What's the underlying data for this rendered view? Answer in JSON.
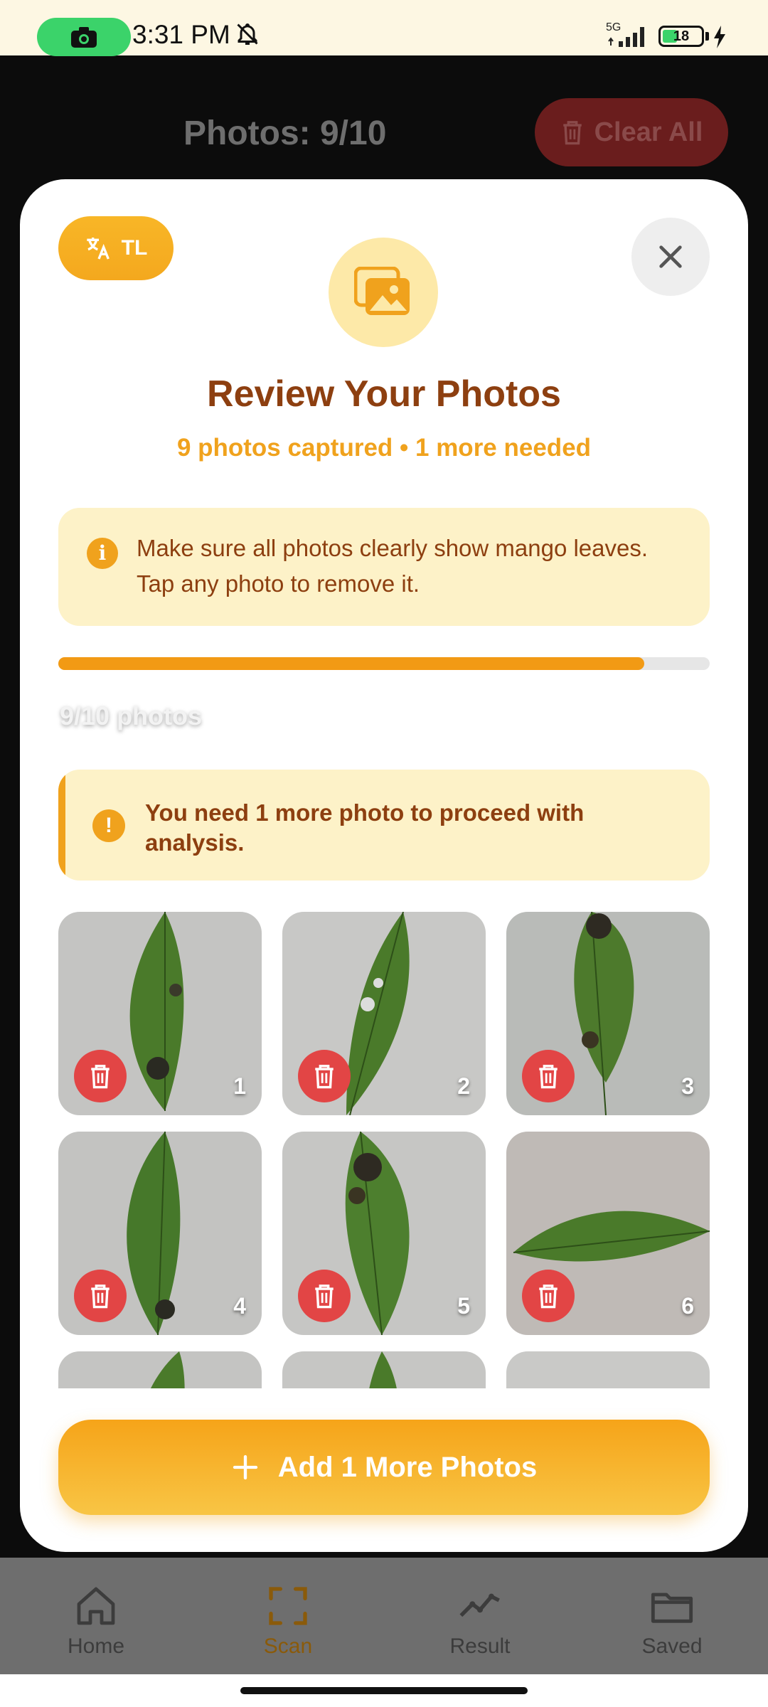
{
  "status_bar": {
    "time": "3:31 PM",
    "network": "5G",
    "battery": "18",
    "icons": [
      "screen-record-icon",
      "bell-off-icon",
      "signal-icon",
      "battery-icon",
      "charging-icon"
    ]
  },
  "background": {
    "title": "Photos: 9/10",
    "clear_all_label": "Clear All"
  },
  "modal": {
    "language_label": "TL",
    "title": "Review Your Photos",
    "subtitle": "9 photos captured • 1 more needed",
    "info_text": "Make sure all photos clearly show mango leaves. Tap any photo to remove it.",
    "progress": {
      "current": 9,
      "total": 10,
      "fraction": 0.9,
      "label": "9/10 photos"
    },
    "warning_text": "You need 1 more photo to proceed with analysis.",
    "photos": [
      {
        "number": "1"
      },
      {
        "number": "2"
      },
      {
        "number": "3"
      },
      {
        "number": "4"
      },
      {
        "number": "5"
      },
      {
        "number": "6"
      }
    ],
    "add_button_label": "Add 1 More Photos"
  },
  "bottom_nav": {
    "items": [
      {
        "label": "Home",
        "icon": "home-icon",
        "active": false
      },
      {
        "label": "Scan",
        "icon": "scan-icon",
        "active": true
      },
      {
        "label": "Result",
        "icon": "result-icon",
        "active": false
      },
      {
        "label": "Saved",
        "icon": "folder-icon",
        "active": false
      }
    ]
  },
  "colors": {
    "accent": "#f0a21d",
    "title_brown": "#8d3f10",
    "delete_red": "#e24545",
    "info_bg": "#fdf2c8"
  }
}
